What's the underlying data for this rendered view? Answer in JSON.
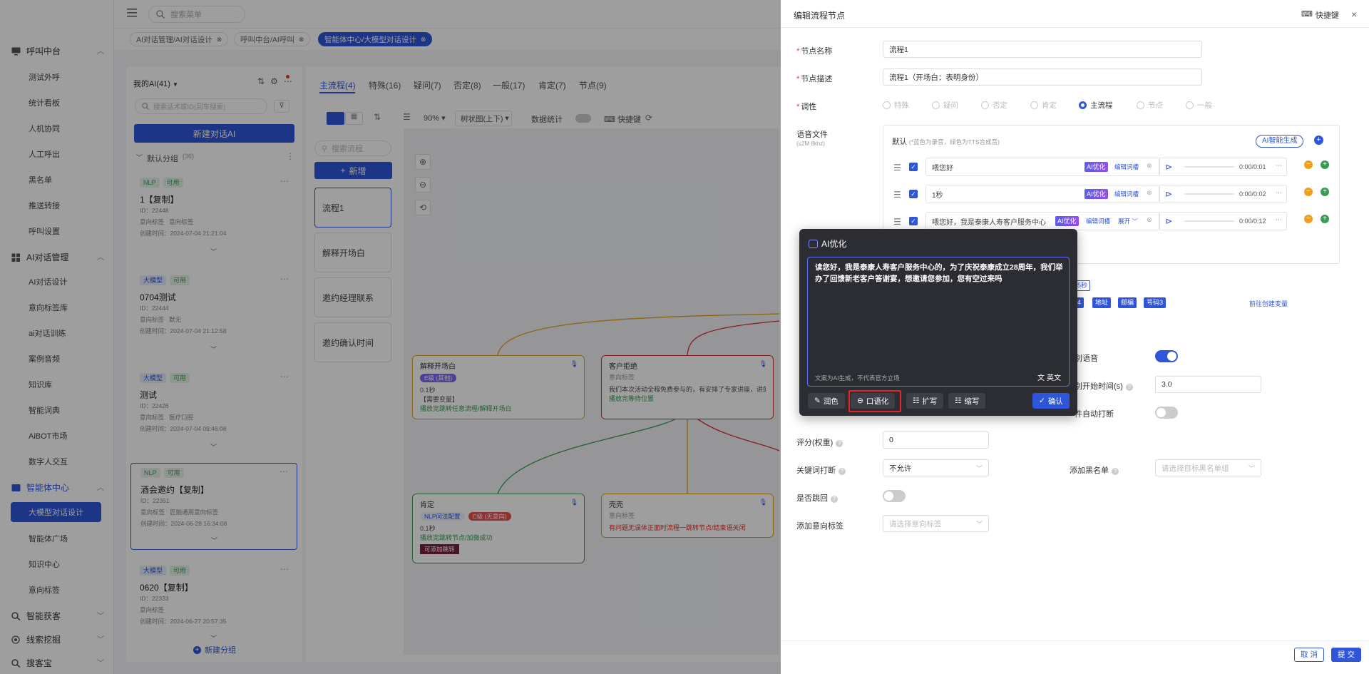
{
  "topbar": {
    "search_placeholder": "搜索菜单"
  },
  "tags": [
    {
      "label": "AI对话管理/AI对话设计"
    },
    {
      "label": "呼叫中台/AI呼叫"
    },
    {
      "label": "智能体中心/大模型对话设计"
    }
  ],
  "sidebar": {
    "groups": {
      "call_center": "呼叫中台",
      "ai_dialog": "AI对话管理",
      "agent_center": "智能体中心",
      "smart_acquire": "智能获客",
      "lead_mining": "线索挖掘",
      "search_guest": "搜客宝"
    },
    "call_items": [
      "测试外呼",
      "统计看板",
      "人机协同",
      "人工呼出",
      "黑名单",
      "推送转接",
      "呼叫设置"
    ],
    "dialog_items": [
      "AI对话设计",
      "意向标签库",
      "ai对话训练",
      "案例音频",
      "知识库",
      "智能词典",
      "AiBOT市场",
      "数字人交互"
    ],
    "agent_items": [
      "大模型对话设计",
      "智能体广场",
      "知识中心",
      "意向标签"
    ]
  },
  "list": {
    "title": "我的AI(41)",
    "search_placeholder": "搜索话术或ID(回车搜索)",
    "new_button": "新建对话AI",
    "group_label": "默认分组",
    "group_count": "(36)",
    "add_group": "新建分组",
    "cards": [
      {
        "type": "NLP",
        "status": "可用",
        "name": "1【复制】",
        "id": "ID：22448",
        "tag_label": "意向标签",
        "tag_value": "意向标签",
        "created": "创建时间：2024-07-04 21:21:04"
      },
      {
        "type": "大模型",
        "status": "可用",
        "name": "0704测试",
        "id": "ID：22444",
        "tag_label": "意向标签",
        "tag_value": "默无",
        "created": "创建时间：2024-07-04 21:12:58"
      },
      {
        "type": "大模型",
        "status": "可用",
        "name": "测试",
        "id": "ID：22426",
        "tag_label": "意向标签",
        "tag_value": "医疗口腔",
        "created": "创建时间：2024-07-04 09:46:08"
      },
      {
        "type": "NLP",
        "status": "可用",
        "name": "酒会邀约【复制】",
        "id": "ID：22351",
        "tag_label": "意向标签",
        "tag_value": "匠融通用意向标签",
        "created": "创建时间：2024-06-28 16:34:08"
      },
      {
        "type": "大模型",
        "status": "可用",
        "name": "0620【复制】",
        "id": "ID：22333",
        "tag_label": "意向标签",
        "tag_value": "",
        "created": "创建时间：2024-06-27 20:57:35"
      }
    ]
  },
  "process": {
    "tabs": [
      "主流程(4)",
      "特殊(16)",
      "疑问(7)",
      "否定(8)",
      "一般(17)",
      "肯定(7)",
      "节点(9)"
    ],
    "search_placeholder": "搜索流程",
    "add_button": "新增",
    "zoom": "90%",
    "layout": "树状图(上下)",
    "stats_label": "数据统计",
    "shortcut_label": "快捷键",
    "flows": [
      "流程1",
      "解释开场白",
      "邀约经理联系",
      "邀约确认时间"
    ],
    "nodes": {
      "n1": {
        "title": "解释开场白",
        "tag": "E级 (其他)",
        "l1": "0.1秒",
        "l2": "【需要变量】",
        "l3": "播放完跳转任意流程/解释开场白"
      },
      "n2": {
        "title": "客户拒绝",
        "sub": "意向标签",
        "l1": "我们本次活动全程免费参与的，有安排了专家讲座，讲的是养老养",
        "l2": "播放完等待位置"
      },
      "n3": {
        "title": "肯定",
        "tag1": "NLP问法配置",
        "tag2": "C级 (无意向)",
        "l1": "0.1秒",
        "l2": "播放完跳转节点/加微成功",
        "btn": "可添加跳转"
      },
      "n4": {
        "title": "壳壳",
        "sub": "意向标签",
        "l1": "有问题无误体正面时流程一跳转节点/结束语关闭"
      }
    }
  },
  "drawer": {
    "title": "编辑流程节点",
    "shortcut": "快捷键",
    "node_name_label": "节点名称",
    "node_name_value": "流程1",
    "node_desc_label": "节点描述",
    "node_desc_value": "流程1（开场白：表明身份）",
    "tone_label": "调性",
    "tone_options": [
      "特殊",
      "疑问",
      "否定",
      "肯定",
      "主流程",
      "节点",
      "一般"
    ],
    "tone_selected": "主流程",
    "voice_label": "语音文件",
    "voice_sub": "(≤2M 8khz)",
    "default_label": "默认",
    "default_hint": "(*蓝色为录音，绿色为TTS合成音)",
    "ai_generate": "AI智能生成",
    "voices": [
      {
        "text": "喂您好",
        "ai": "AI优化",
        "edit": "编辑词槽",
        "time": "0:00/0:01"
      },
      {
        "text": "1秒",
        "ai": "AI优化",
        "edit": "编辑词槽",
        "time": "0:00/0:02"
      },
      {
        "text": "喂您好，我是泰康人寿客户服务中心",
        "ai": "AI优化",
        "edit": "编辑词槽",
        "expand": "展开",
        "time": "0:00/0:12"
      }
    ],
    "pause_chip": "5秒",
    "var_chips": [
      "4",
      "地址",
      "邮编",
      "号码3"
    ],
    "new_var": "前往创建变量",
    "speech_recog": "别语音",
    "recog_start": "别开始时间(s)",
    "recog_start_value": "3.0",
    "auto_interrupt": "件自动打断",
    "score_label": "评分(权重)",
    "score_value": "0",
    "kw_interrupt_label": "关键词打断",
    "kw_interrupt_value": "不允许",
    "blacklist_label": "添加黑名单",
    "blacklist_placeholder": "请选择目标黑名单组",
    "repeat_label": "是否跳回",
    "intent_label": "添加意向标签",
    "intent_placeholder": "请选择意向标签",
    "cancel": "取 消",
    "submit": "提 交"
  },
  "ai_popover": {
    "title": "AI优化",
    "content": "读您好，我是泰康人寿客户服务中心的，为了庆祝泰康成立28周年，我们举办了回馈新老客户答谢宴，想邀请您参加，您有空过来吗",
    "disclaimer": "文案为AI生成，不代表官方立场",
    "lang": "英文",
    "buttons": [
      "润色",
      "口语化",
      "扩写",
      "缩写"
    ],
    "confirm": "确认"
  },
  "colors": {
    "accent": "#2f56d8",
    "highlight_box": "#e8222a"
  }
}
